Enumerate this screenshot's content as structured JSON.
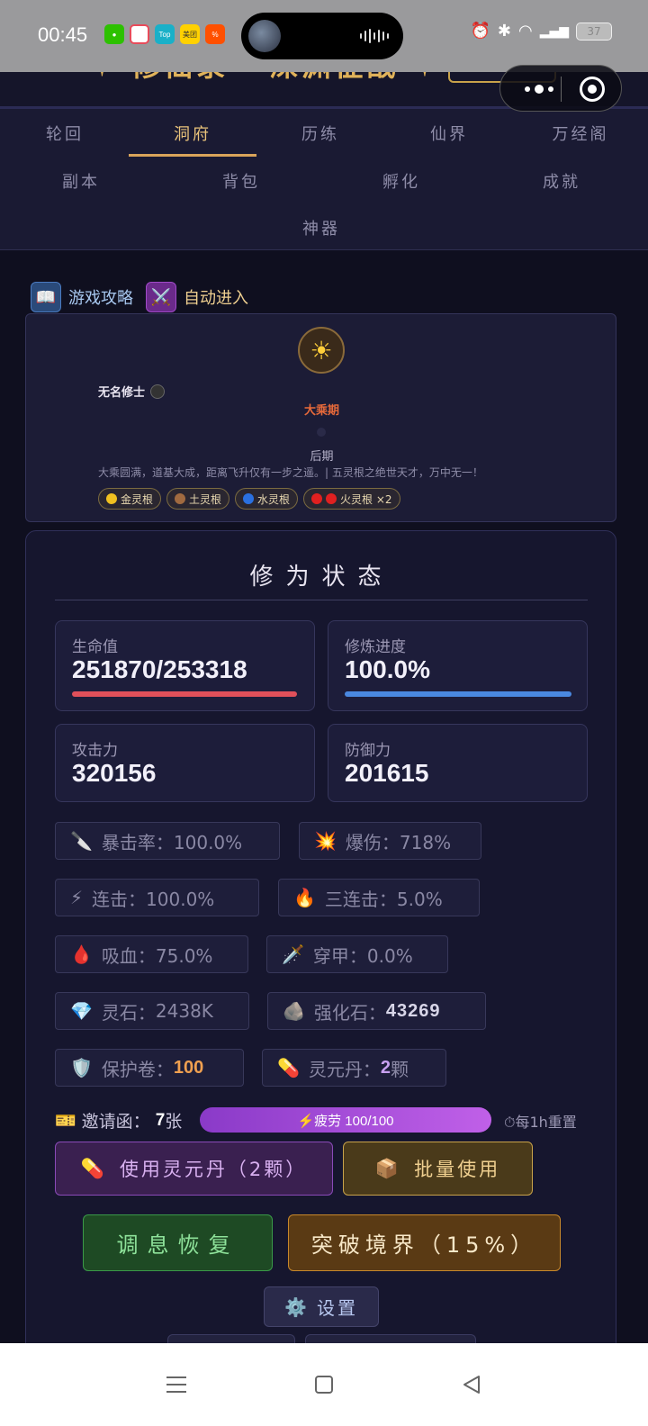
{
  "status_bar": {
    "time": "00:45",
    "apps": [
      {
        "name": "wechat-icon",
        "label": "",
        "color": "#2dc100"
      },
      {
        "name": "app-colorful-icon",
        "label": "",
        "color": "#e84b5a"
      },
      {
        "name": "top-app-icon",
        "label": "Top",
        "color": "#1ab0c8"
      },
      {
        "name": "meituan-icon",
        "label": "美团",
        "color": "#ffd100"
      },
      {
        "name": "taobao-icon",
        "label": "%",
        "color": "#ff5000"
      }
    ],
    "battery": "37"
  },
  "header": {
    "title": "✦ 修仙录 · 深渊征战 ✦"
  },
  "nav": {
    "tabs": [
      {
        "label": "轮回",
        "active": false
      },
      {
        "label": "洞府",
        "active": true
      },
      {
        "label": "历练",
        "active": false
      },
      {
        "label": "仙界",
        "active": false
      },
      {
        "label": "万经阁",
        "active": false
      },
      {
        "label": "副本",
        "active": false
      },
      {
        "label": "背包",
        "active": false
      },
      {
        "label": "孵化",
        "active": false
      },
      {
        "label": "成就",
        "active": false
      },
      {
        "label": "神器",
        "active": false
      }
    ]
  },
  "guide": {
    "strategy_label": "游戏攻略",
    "auto_label": "自动进入"
  },
  "profile": {
    "name": "无名修士",
    "realm": "大乘期",
    "stage": "后期",
    "description": "大乘圆满，道基大成，距离飞升仅有一步之遥。| 五灵根之绝世天才，万中无一！",
    "roots": [
      {
        "label": "金灵根",
        "colors": [
          "#f0c020"
        ]
      },
      {
        "label": "土灵根",
        "colors": [
          "#a06a40"
        ]
      },
      {
        "label": "水灵根",
        "colors": [
          "#2a70e0"
        ]
      },
      {
        "label": "火灵根 ×2",
        "colors": [
          "#e02020",
          "#e02020"
        ]
      }
    ]
  },
  "status": {
    "title": "修为状态",
    "hp_label": "生命值",
    "hp_value": "251870/253318",
    "hp_fraction": 0.994,
    "progress_label": "修炼进度",
    "progress_value": "100.0%",
    "progress_fraction": 1.0,
    "attack_label": "攻击力",
    "attack_value": "320156",
    "defense_label": "防御力",
    "defense_value": "201615",
    "crit_rate": "暴击率：100.0%",
    "crit_dmg": "爆伤：718%",
    "combo": "连击：100.0%",
    "triple": "三连击：5.0%",
    "lifesteal": "吸血：75.0%",
    "pierce": "穿甲：0.0%",
    "stone_label": "灵石：",
    "stone_value": "2438K",
    "enhance_label": "强化石：",
    "enhance_value": "43269",
    "protect_label": "保护卷：",
    "protect_value": "100",
    "pill_label": "灵元丹：",
    "pill_value": "2",
    "pill_unit": "颗",
    "invite_label": "邀请函：",
    "invite_value": "7",
    "invite_unit": "张",
    "fatigue": "⚡疲劳 100/100",
    "reset": "⏱每1h重置"
  },
  "buttons": {
    "use_pill": "使用灵元丹（2颗）",
    "batch_use": "批量使用",
    "rest": "调息恢复",
    "breakthrough": "突破境界（15%）",
    "settings": "设置"
  },
  "colors": {
    "hp_bar": "#e0505a",
    "progress_bar": "#4a88e0",
    "gold": "#e0b25a"
  }
}
